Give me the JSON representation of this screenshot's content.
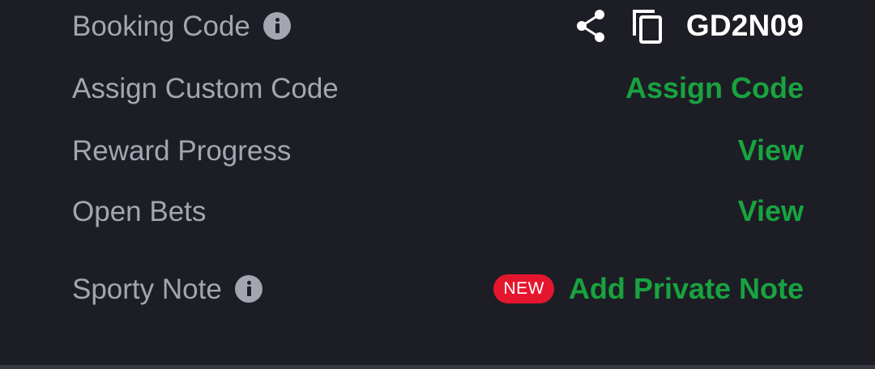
{
  "rows": {
    "booking_code": {
      "label": "Booking Code",
      "code": "GD2N09"
    },
    "assign_custom_code": {
      "label": "Assign Custom Code",
      "action": "Assign Code"
    },
    "reward_progress": {
      "label": "Reward Progress",
      "action": "View"
    },
    "open_bets": {
      "label": "Open Bets",
      "action": "View"
    },
    "sporty_note": {
      "label": "Sporty Note",
      "badge": "NEW",
      "action": "Add Private Note"
    }
  },
  "icons": {
    "info": "info-icon",
    "share": "share-icon",
    "copy": "copy-icon"
  },
  "colors": {
    "background": "#1d1e25",
    "label": "#a3a6b0",
    "action": "#18a340",
    "code": "#ffffff",
    "badge": "#e4162e",
    "divider": "#353741"
  }
}
